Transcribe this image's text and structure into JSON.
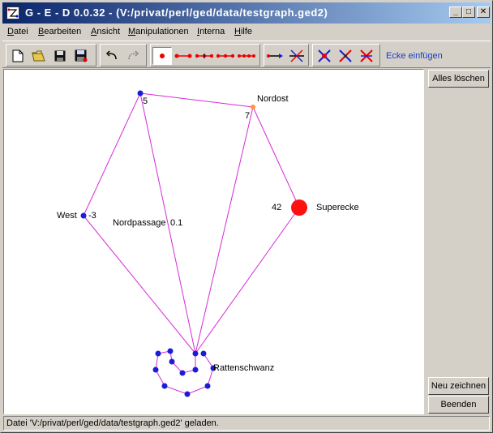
{
  "window": {
    "title": "G - E - D   0.0.32   -   (V:/privat/perl/ged/data/testgraph.ged2)",
    "minimize": "_",
    "maximize": "□",
    "close": "✕"
  },
  "menu": {
    "items": [
      {
        "underline": "D",
        "rest": "atei"
      },
      {
        "underline": "B",
        "rest": "earbeiten"
      },
      {
        "underline": "A",
        "rest": "nsicht"
      },
      {
        "underline": "M",
        "rest": "anipulationen"
      },
      {
        "underline": "I",
        "rest": "nterna"
      },
      {
        "underline": "H",
        "rest": "ilfe"
      }
    ]
  },
  "toolbar": {
    "hint": "Ecke einfügen",
    "file_icons": [
      "new-file-icon",
      "open-folder-icon",
      "save-disk-icon",
      "save-all-icon"
    ],
    "edit_icons": [
      "undo-icon",
      "redo-icon"
    ],
    "mode_icons": [
      "insert-vertex-icon",
      "insert-edge-icon",
      "insert-path-icon",
      "insert-chain-icon",
      "insert-multi-edge-icon"
    ],
    "direct_icons": [
      "directed-edge-icon",
      "cross-edge-icon"
    ],
    "delete_icons": [
      "delete-vertex-icon",
      "delete-edge-icon",
      "delete-all-icon"
    ]
  },
  "graph": {
    "labels": {
      "v5": "5",
      "nordost": "Nordost",
      "v7": "7",
      "west": "West",
      "west_val": "-3",
      "nordpassage": "Nordpassage",
      "np_val": "0.1",
      "super_val": "42",
      "superecke": "Superecke",
      "rattenschwanz": "Rattenschwanz"
    },
    "colors": {
      "edge": "#d62ad6",
      "node": "#1c1cd6",
      "orange": "#ff9a2e",
      "big": "#ff1010"
    }
  },
  "side": {
    "clear": "Alles löschen",
    "redraw": "Neu zeichnen",
    "quit": "Beenden"
  },
  "status": "Datei 'V:/privat/perl/ged/data/testgraph.ged2' geladen."
}
